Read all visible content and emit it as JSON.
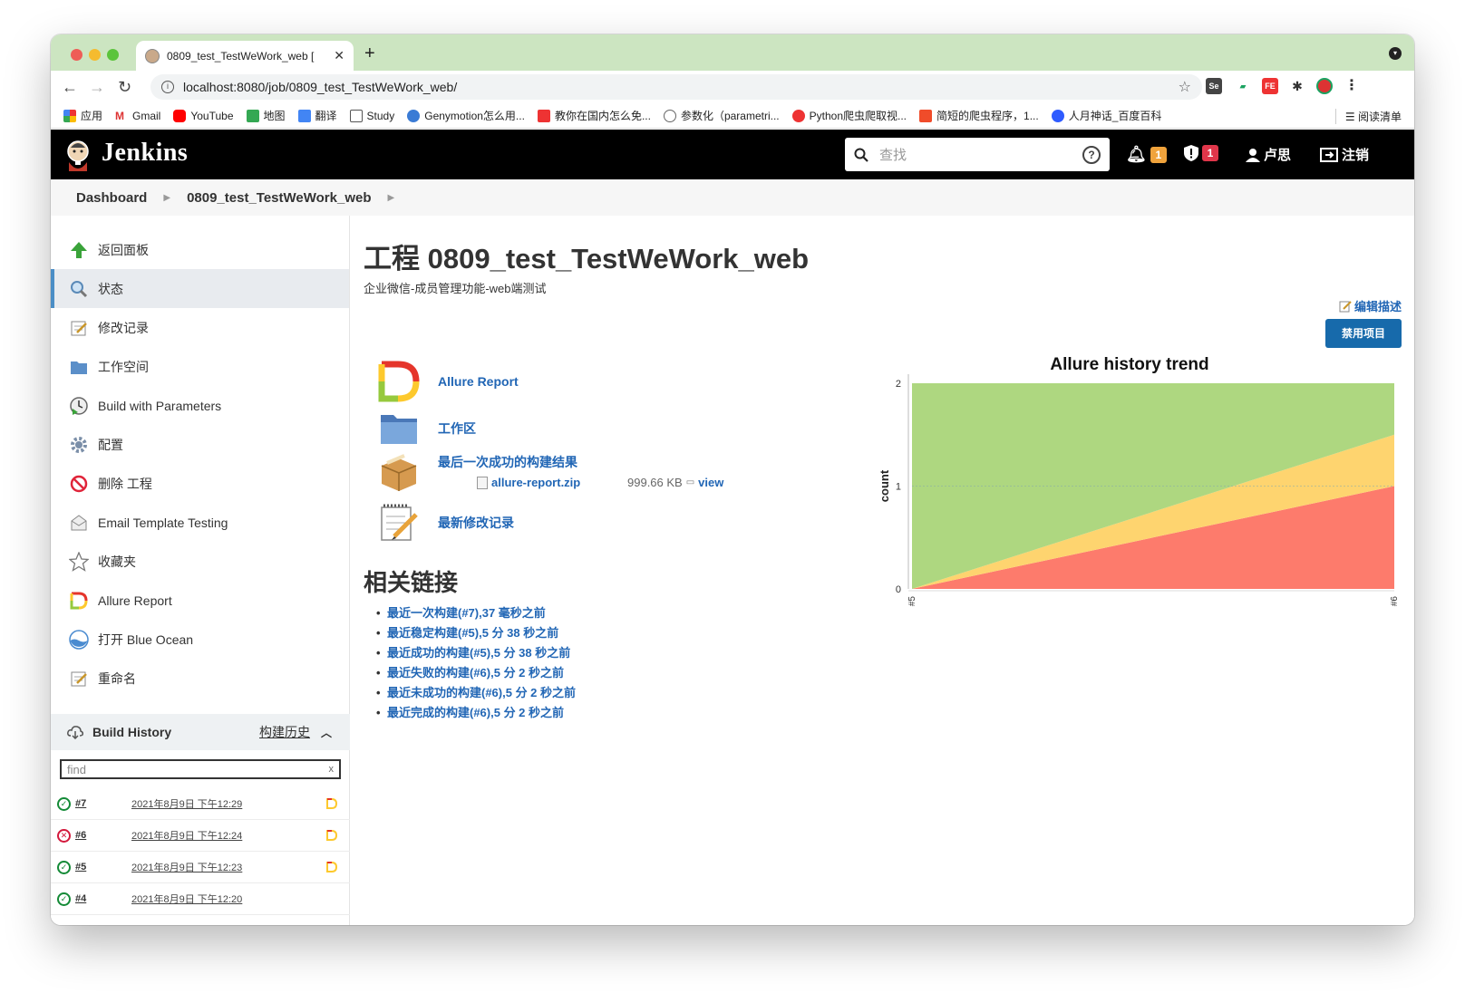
{
  "browser": {
    "tab_title": "0809_test_TestWeWork_web [",
    "url": "localhost:8080/job/0809_test_TestWeWork_web/",
    "bookmarks": [
      "应用",
      "Gmail",
      "YouTube",
      "地图",
      "翻译",
      "Study",
      "Genymotion怎么用...",
      "教你在国内怎么免...",
      "参数化（parametri...",
      "Python爬虫爬取视...",
      "简短的爬虫程序，1...",
      "人月神话_百度百科"
    ],
    "reading_list": "阅读清单"
  },
  "header": {
    "brand": "Jenkins",
    "search_placeholder": "查找",
    "help": "?",
    "notifications_count": "1",
    "security_count": "1",
    "user": "卢思",
    "logout": "注销"
  },
  "breadcrumb": [
    "Dashboard",
    "0809_test_TestWeWork_web"
  ],
  "sidebar": {
    "items": [
      {
        "label": "返回面板",
        "icon": "up-arrow-icon"
      },
      {
        "label": "状态",
        "icon": "magnifier-icon"
      },
      {
        "label": "修改记录",
        "icon": "notepad-icon"
      },
      {
        "label": "工作空间",
        "icon": "folder-icon"
      },
      {
        "label": "Build with Parameters",
        "icon": "clock-play-icon"
      },
      {
        "label": "配置",
        "icon": "gear-icon"
      },
      {
        "label": "删除 工程",
        "icon": "no-entry-icon"
      },
      {
        "label": "Email Template Testing",
        "icon": "envelope-icon"
      },
      {
        "label": "收藏夹",
        "icon": "star-icon"
      },
      {
        "label": "Allure Report",
        "icon": "allure-icon"
      },
      {
        "label": "打开 Blue Ocean",
        "icon": "blue-ocean-icon"
      },
      {
        "label": "重命名",
        "icon": "notepad-icon"
      }
    ]
  },
  "build_history": {
    "title": "Build History",
    "link": "构建历史",
    "filter_placeholder": "find",
    "rows": [
      {
        "status": "success",
        "num": "#7",
        "date": "2021年8月9日 下午12:29"
      },
      {
        "status": "failure",
        "num": "#6",
        "date": "2021年8月9日 下午12:24"
      },
      {
        "status": "success",
        "num": "#5",
        "date": "2021年8月9日 下午12:23"
      },
      {
        "status": "success",
        "num": "#4",
        "date": "2021年8月9日 下午12:20"
      }
    ]
  },
  "main": {
    "title": "工程 0809_test_TestWeWork_web",
    "description": "企业微信-成员管理功能-web端测试",
    "edit_description": "编辑描述",
    "disable_button": "禁用项目",
    "links": [
      {
        "label": "Allure Report",
        "icon": "allure-icon"
      },
      {
        "label": "工作区",
        "icon": "folder-icon"
      },
      {
        "label": "最后一次成功的构建结果",
        "icon": "package-icon"
      },
      {
        "label": "最新修改记录",
        "icon": "notepad-icon"
      }
    ],
    "artifact": {
      "name": "allure-report.zip",
      "size": "999.66 KB",
      "view": "view"
    },
    "related_title": "相关链接",
    "related_links": [
      "最近一次构建(#7),37 毫秒之前",
      "最近稳定构建(#5),5 分 38 秒之前",
      "最近成功的构建(#5),5 分 38 秒之前",
      "最近失败的构建(#6),5 分 2 秒之前",
      "最近未成功的构建(#6),5 分 2 秒之前",
      "最近完成的构建(#6),5 分 2 秒之前"
    ]
  },
  "chart_data": {
    "type": "area",
    "title": "Allure history trend",
    "ylabel": "count",
    "x": [
      "#5",
      "#6"
    ],
    "ylim": [
      0,
      2
    ],
    "yticks": [
      0,
      1,
      2
    ],
    "stacked": true,
    "series": [
      {
        "values": [
          0,
          1
        ],
        "color": "#fd7b6c"
      },
      {
        "values": [
          0,
          0.5
        ],
        "color": "#fed46f"
      },
      {
        "values": [
          2,
          0.5
        ],
        "color": "#aed780"
      }
    ]
  }
}
